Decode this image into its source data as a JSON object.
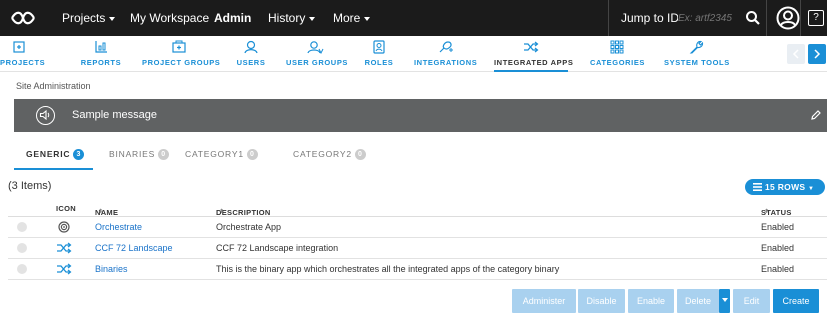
{
  "topnav": {
    "logo": "repository-logo-icon",
    "items": [
      {
        "label": "Projects",
        "dropdown": true
      },
      {
        "label": "My Workspace",
        "dropdown": false
      },
      {
        "label": "Admin",
        "dropdown": false,
        "active": true
      },
      {
        "label": "History",
        "dropdown": true
      },
      {
        "label": "More",
        "dropdown": true
      }
    ],
    "jump_to_id": "Jump to ID",
    "jump_placeholder": "Ex: artf2345",
    "help_label": "?"
  },
  "admin_tabs": [
    {
      "label": "PROJECTS",
      "icon": "projects-icon"
    },
    {
      "label": "REPORTS",
      "icon": "reports-icon"
    },
    {
      "label": "PROJECT GROUPS",
      "icon": "project-groups-icon"
    },
    {
      "label": "USERS",
      "icon": "users-icon"
    },
    {
      "label": "USER GROUPS",
      "icon": "user-groups-icon"
    },
    {
      "label": "ROLES",
      "icon": "roles-icon"
    },
    {
      "label": "INTEGRATIONS",
      "icon": "integrations-icon"
    },
    {
      "label": "INTEGRATED APPS",
      "icon": "integrated-apps-icon",
      "active": true
    },
    {
      "label": "CATEGORIES",
      "icon": "categories-icon"
    },
    {
      "label": "SYSTEM TOOLS",
      "icon": "system-tools-icon"
    }
  ],
  "breadcrumb": "Site Administration",
  "message": {
    "text": "Sample message"
  },
  "content_tabs": [
    {
      "label": "GENERIC",
      "count": "3",
      "active": true
    },
    {
      "label": "BINARIES",
      "count": "0"
    },
    {
      "label": "CATEGORY1",
      "count": "0"
    },
    {
      "label": "CATEGORY2",
      "count": "0"
    }
  ],
  "items_count": "(3 Items)",
  "rows_button": "15 ROWS",
  "table": {
    "columns": [
      "ICON",
      "NAME",
      "DESCRIPTION",
      "STATUS"
    ],
    "rows": [
      {
        "icon": "orchestrate-icon",
        "name": "Orchestrate",
        "description": "Orchestrate App",
        "status": "Enabled"
      },
      {
        "icon": "shuffle-icon",
        "name": "CCF 72 Landscape",
        "description": "CCF 72 Landscape integration",
        "status": "Enabled"
      },
      {
        "icon": "shuffle-icon",
        "name": "Binaries",
        "description": "This is the binary app which orchestrates all the integrated apps of the category binary",
        "status": "Enabled"
      }
    ]
  },
  "actions": {
    "administer": "Administer",
    "disable": "Disable",
    "enable": "Enable",
    "delete": "Delete",
    "edit": "Edit",
    "create": "Create"
  },
  "colors": {
    "accent": "#1a8fd6",
    "topbar": "#1b1b1b",
    "message_bar": "#606263",
    "disabled_button": "#a9d1ef"
  }
}
